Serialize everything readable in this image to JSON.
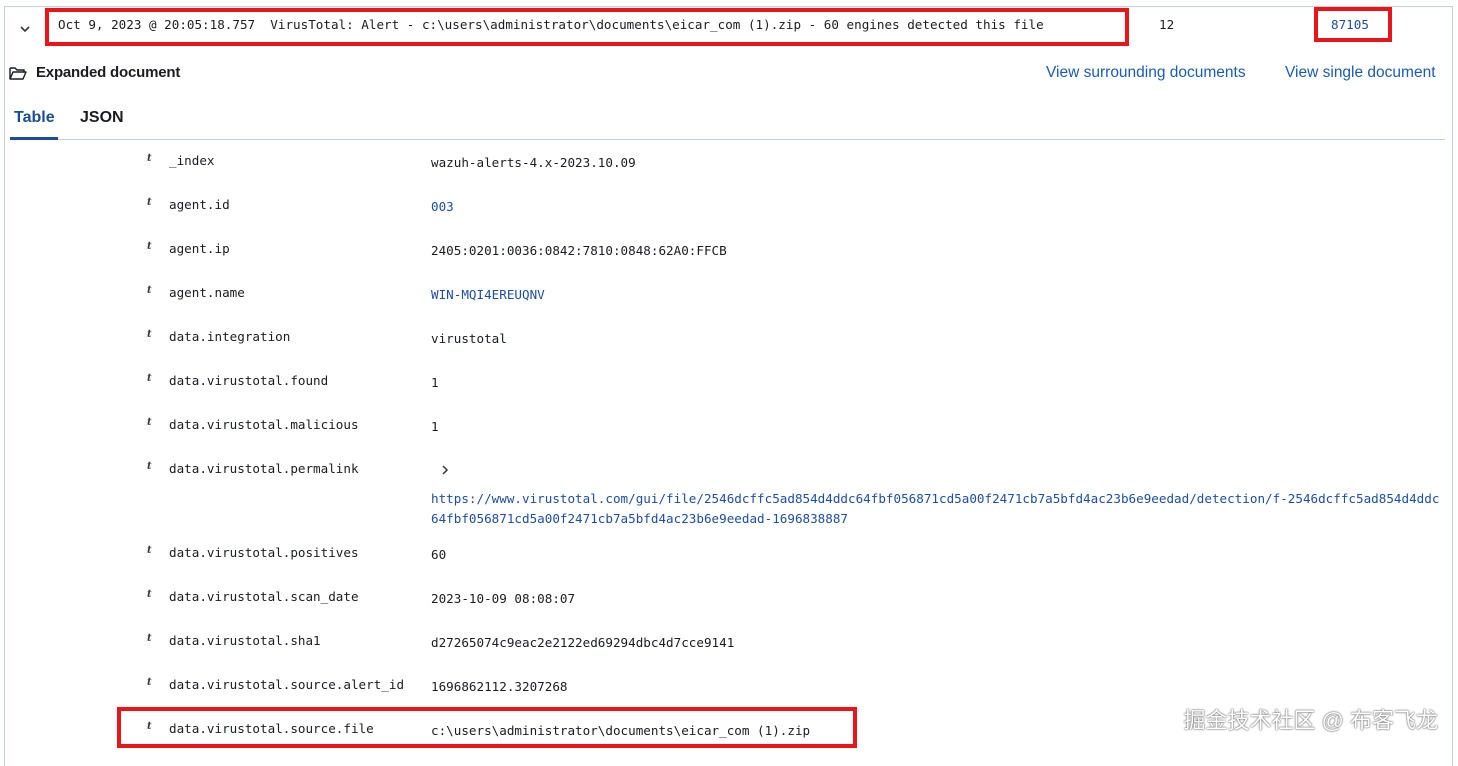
{
  "summary": {
    "text": "Oct 9, 2023 @ 20:05:18.757  VirusTotal: Alert - c:\\users\\administrator\\documents\\eicar_com (1).zip - 60 engines detected this file",
    "count": "12",
    "rule_id": "87105"
  },
  "expanded": {
    "title": "Expanded document",
    "view_surrounding": "View surrounding documents",
    "view_single": "View single document",
    "tabs": [
      "Table",
      "JSON"
    ]
  },
  "type_glyph": "t",
  "fields": [
    {
      "name": "_index",
      "value": "wazuh-alerts-4.x-2023.10.09"
    },
    {
      "name": "agent.id",
      "value": "003"
    },
    {
      "name": "agent.ip",
      "value": "2405:0201:0036:0842:7810:0848:62A0:FFCB"
    },
    {
      "name": "agent.name",
      "value": "WIN-MQI4EREUQNV"
    },
    {
      "name": "data.integration",
      "value": "virustotal"
    },
    {
      "name": "data.virustotal.found",
      "value": "1"
    },
    {
      "name": "data.virustotal.malicious",
      "value": "1"
    },
    {
      "name": "data.virustotal.permalink",
      "value": "https://www.virustotal.com/gui/file/2546dcffc5ad854d4ddc64fbf056871cd5a00f2471cb7a5bfd4ac23b6e9eedad/detection/f-2546dcffc5ad854d4ddc64fbf056871cd5a00f2471cb7a5bfd4ac23b6e9eedad-1696838887"
    },
    {
      "name": "data.virustotal.positives",
      "value": "60"
    },
    {
      "name": "data.virustotal.scan_date",
      "value": "2023-10-09 08:08:07"
    },
    {
      "name": "data.virustotal.sha1",
      "value": "d27265074c9eac2e2122ed69294dbc4d7cce9141"
    },
    {
      "name": "data.virustotal.source.alert_id",
      "value": "1696862112.3207268"
    },
    {
      "name": "data.virustotal.source.file",
      "value": "c:\\users\\administrator\\documents\\eicar_com (1).zip"
    }
  ],
  "watermark": "掘金技术社区 @ 布客飞龙",
  "colors": {
    "highlight": "#e8151b",
    "link": "#1b5bb0",
    "tab_active": "#1b4d97"
  }
}
